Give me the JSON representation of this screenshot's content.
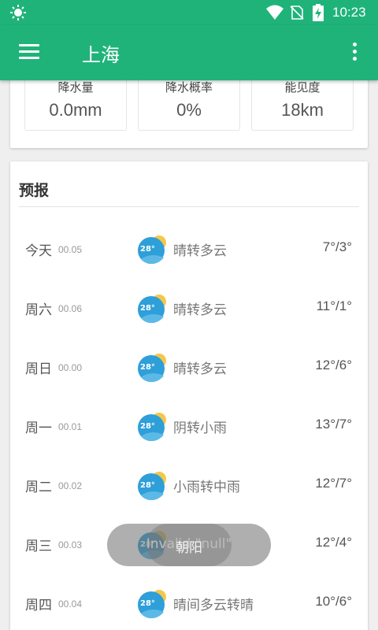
{
  "status_bar": {
    "time": "10:23"
  },
  "app_bar": {
    "title": "上海"
  },
  "metrics": [
    {
      "label": "降水量",
      "value": "0.0mm"
    },
    {
      "label": "降水概率",
      "value": "0%"
    },
    {
      "label": "能见度",
      "value": "18km"
    }
  ],
  "forecast": {
    "title": "预报",
    "icon_text": "28°",
    "rows": [
      {
        "day": "今天",
        "date": "00.05",
        "condition": "晴转多云",
        "temp": "7°/3°"
      },
      {
        "day": "周六",
        "date": "00.06",
        "condition": "晴转多云",
        "temp": "11°/1°"
      },
      {
        "day": "周日",
        "date": "00.00",
        "condition": "晴转多云",
        "temp": "12°/6°"
      },
      {
        "day": "周一",
        "date": "00.01",
        "condition": "阴转小雨",
        "temp": "13°/7°"
      },
      {
        "day": "周二",
        "date": "00.02",
        "condition": "小雨转中雨",
        "temp": "12°/7°"
      },
      {
        "day": "周三",
        "date": "00.03",
        "condition": "",
        "temp": "12°/4°"
      },
      {
        "day": "周四",
        "date": "00.04",
        "condition": "晴间多云转晴",
        "temp": "10°/6°"
      }
    ]
  },
  "toasts": {
    "back": "Invalid \"null\"",
    "front": "朝阳"
  },
  "colors": {
    "primary": "#1fb37a",
    "icon_blue": "#2e9fd8",
    "icon_sun": "#f3c84a"
  }
}
